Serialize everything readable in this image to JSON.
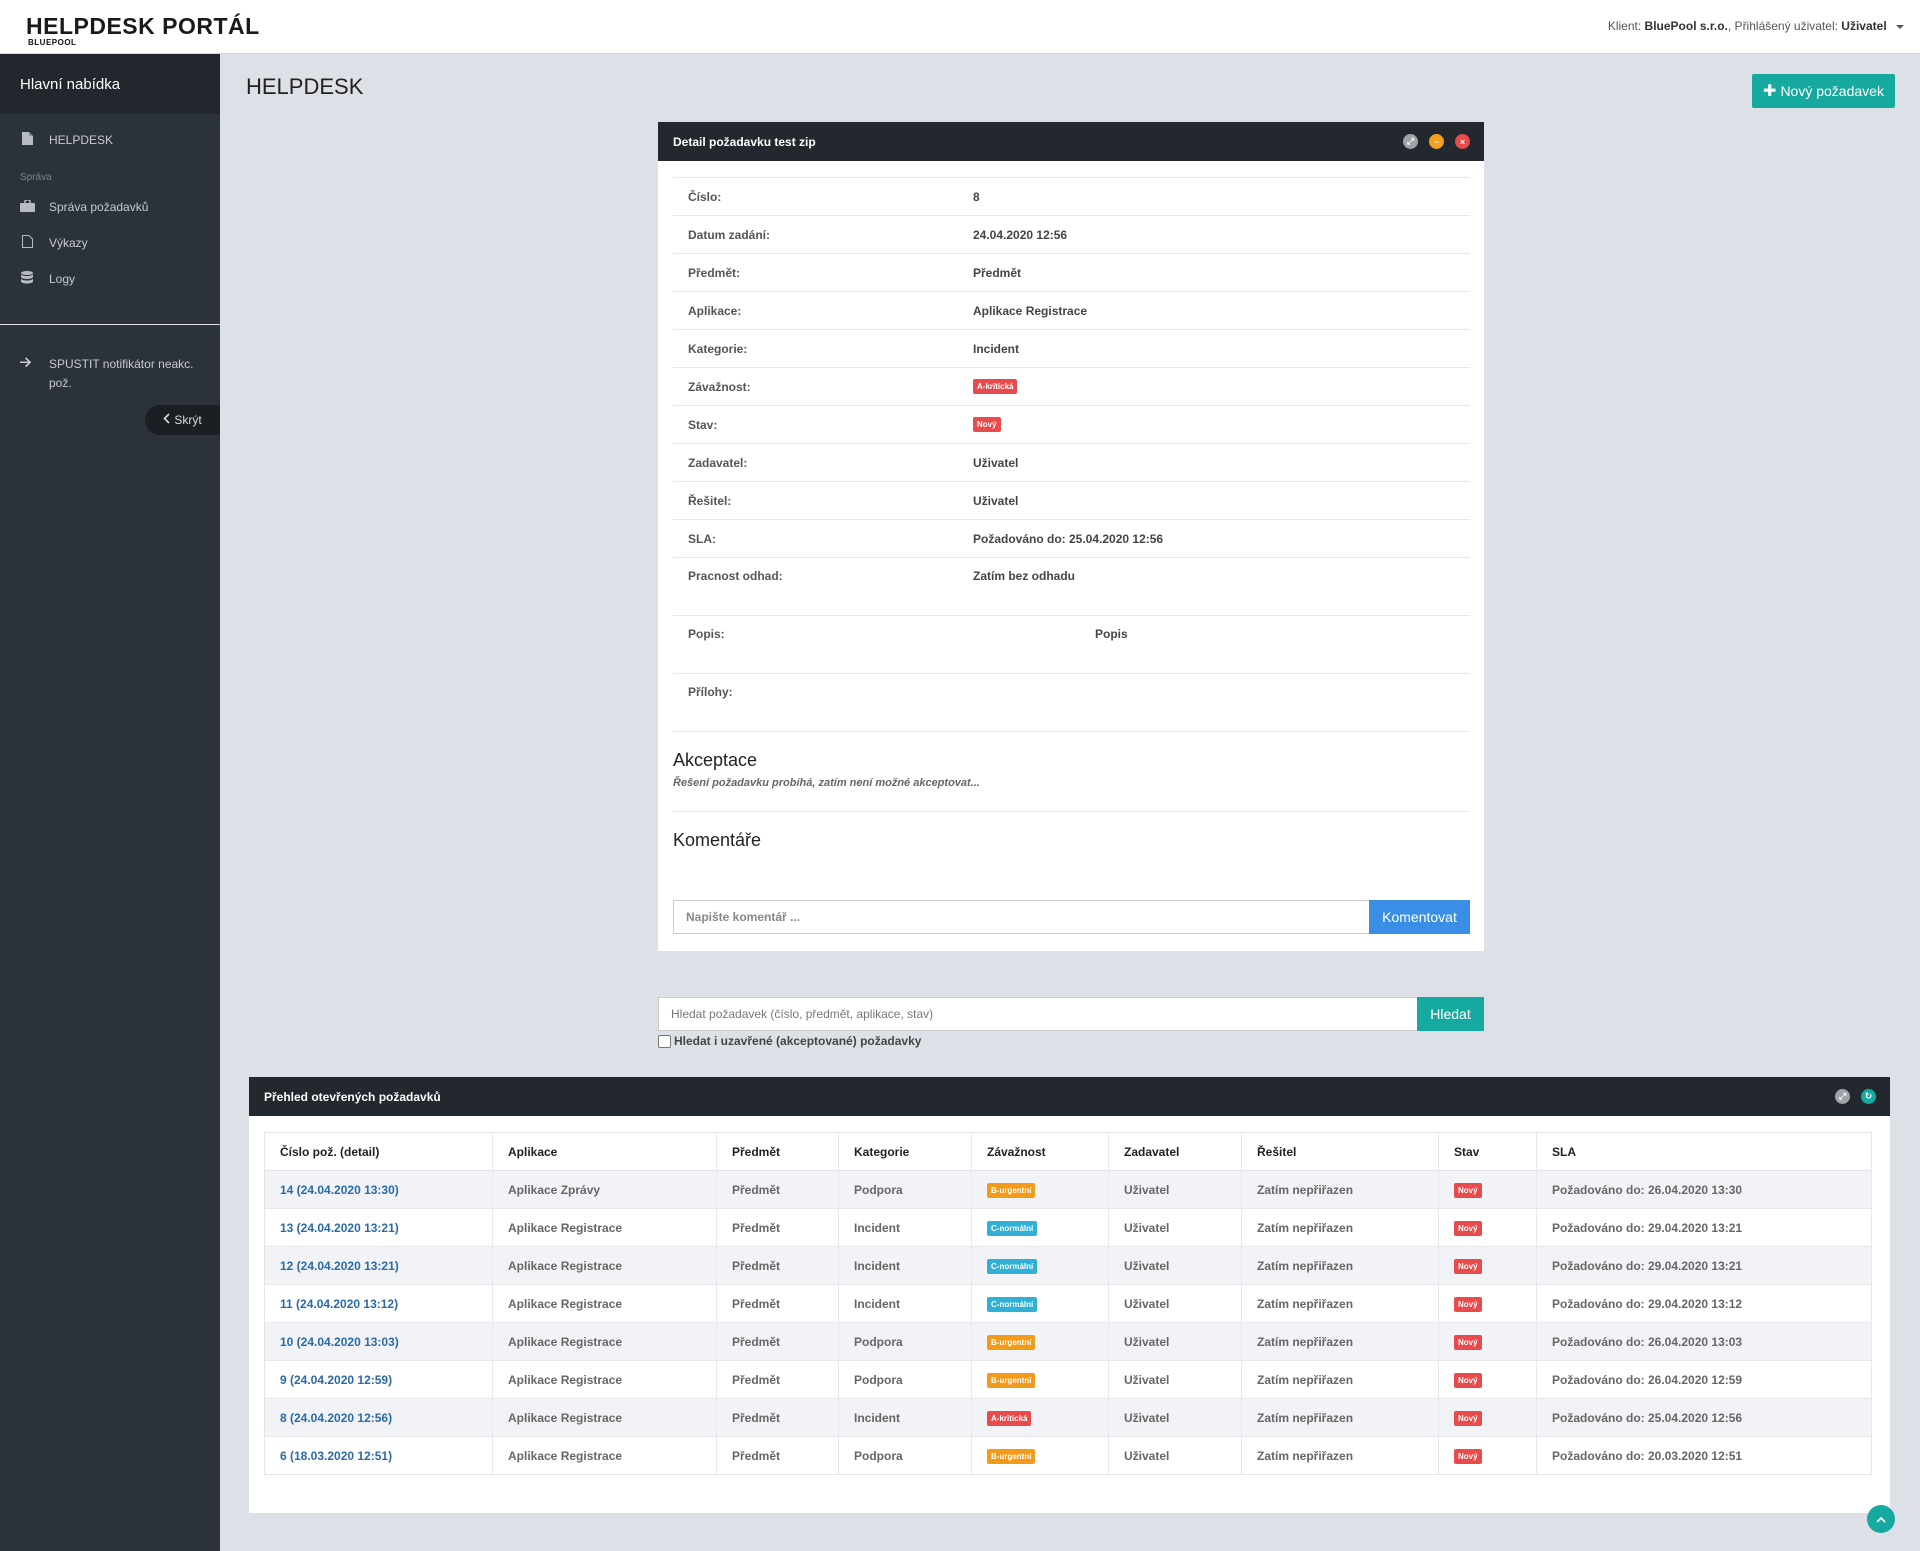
{
  "header": {
    "logo_title": "HELPDESK PORTÁL",
    "logo_sub": "BLUEPOOL",
    "client_label": "Klient:",
    "client_name": "BluePool s.r.o.",
    "user_label": ", Přihlášený uživatel:",
    "user_name": "Uživatel"
  },
  "sidebar": {
    "title": "Hlavní nabídka",
    "items": [
      {
        "label": "HELPDESK",
        "icon": "file-icon"
      },
      {
        "label": "Správa požadavků",
        "icon": "briefcase-icon"
      },
      {
        "label": "Výkazy",
        "icon": "document-icon"
      },
      {
        "label": "Logy",
        "icon": "database-icon"
      }
    ],
    "section_label": "Správa",
    "notifier_label": "SPUSTIT notifikátor neakc. pož.",
    "hide_label": "Skrýt"
  },
  "page": {
    "title": "HELPDESK",
    "new_button": "Nový požadavek"
  },
  "detail": {
    "title": "Detail požadavku test zip",
    "rows": [
      {
        "label": "Číslo:",
        "value": "8"
      },
      {
        "label": "Datum zadání:",
        "value": "24.04.2020 12:56"
      },
      {
        "label": "Předmět:",
        "value": "Předmět"
      },
      {
        "label": "Aplikace:",
        "value": "Aplikace Registrace"
      },
      {
        "label": "Kategorie:",
        "value": "Incident"
      },
      {
        "label": "Závažnost:",
        "value": "A-kritická"
      },
      {
        "label": "Stav:",
        "value": "Nový"
      },
      {
        "label": "Zadavatel:",
        "value": "Uživatel"
      },
      {
        "label": "Řešitel:",
        "value": "Uživatel"
      },
      {
        "label": "SLA:",
        "value": "Požadováno do: 25.04.2020 12:56"
      },
      {
        "label": "Pracnost odhad:",
        "value": "Zatím bez odhadu"
      },
      {
        "label": "Popis:",
        "value": "Popis"
      },
      {
        "label": "Přílohy:",
        "value": ""
      }
    ],
    "acceptance_title": "Akceptace",
    "acceptance_note": "Řešení požadavku probíhá, zatím není možné akceptovat...",
    "comments_title": "Komentáře",
    "comment_placeholder": "Napište komentář ...",
    "comment_button": "Komentovat"
  },
  "search": {
    "placeholder": "Hledat požadavek (číslo, předmět, aplikace, stav)",
    "button": "Hledat",
    "checkbox_label": "Hledat i uzavřené (akceptované) požadavky"
  },
  "overview": {
    "title": "Přehled otevřených požadavků",
    "columns": [
      "Číslo pož. (detail)",
      "Aplikace",
      "Předmět",
      "Kategorie",
      "Závažnost",
      "Zadavatel",
      "Řešitel",
      "Stav",
      "SLA"
    ],
    "rows": [
      {
        "id": "14 (24.04.2020 13:30)",
        "app": "Aplikace Zprávy",
        "subject": "Předmět",
        "category": "Podpora",
        "severity": "B-urgentní",
        "severity_color": "#f29b1a",
        "requester": "Uživatel",
        "solver": "Zatím nepřiřazen",
        "state": "Nový",
        "sla": "Požadováno do: 26.04.2020 13:30"
      },
      {
        "id": "13 (24.04.2020 13:21)",
        "app": "Aplikace Registrace",
        "subject": "Předmět",
        "category": "Incident",
        "severity": "C-normální",
        "severity_color": "#31b0d5",
        "requester": "Uživatel",
        "solver": "Zatím nepřiřazen",
        "state": "Nový",
        "sla": "Požadováno do: 29.04.2020 13:21"
      },
      {
        "id": "12 (24.04.2020 13:21)",
        "app": "Aplikace Registrace",
        "subject": "Předmět",
        "category": "Incident",
        "severity": "C-normální",
        "severity_color": "#31b0d5",
        "requester": "Uživatel",
        "solver": "Zatím nepřiřazen",
        "state": "Nový",
        "sla": "Požadováno do: 29.04.2020 13:21"
      },
      {
        "id": "11 (24.04.2020 13:12)",
        "app": "Aplikace Registrace",
        "subject": "Předmět",
        "category": "Incident",
        "severity": "C-normální",
        "severity_color": "#31b0d5",
        "requester": "Uživatel",
        "solver": "Zatím nepřiřazen",
        "state": "Nový",
        "sla": "Požadováno do: 29.04.2020 13:12"
      },
      {
        "id": "10 (24.04.2020 13:03)",
        "app": "Aplikace Registrace",
        "subject": "Předmět",
        "category": "Podpora",
        "severity": "B-urgentní",
        "severity_color": "#f29b1a",
        "requester": "Uživatel",
        "solver": "Zatím nepřiřazen",
        "state": "Nový",
        "sla": "Požadováno do: 26.04.2020 13:03"
      },
      {
        "id": "9 (24.04.2020 12:59)",
        "app": "Aplikace Registrace",
        "subject": "Předmět",
        "category": "Podpora",
        "severity": "B-urgentní",
        "severity_color": "#f29b1a",
        "requester": "Uživatel",
        "solver": "Zatím nepřiřazen",
        "state": "Nový",
        "sla": "Požadováno do: 26.04.2020 12:59"
      },
      {
        "id": "8 (24.04.2020 12:56)",
        "app": "Aplikace Registrace",
        "subject": "Předmět",
        "category": "Incident",
        "severity": "A-kritická",
        "severity_color": "#e84b4b",
        "requester": "Uživatel",
        "solver": "Zatím nepřiřazen",
        "state": "Nový",
        "sla": "Požadováno do: 25.04.2020 12:56"
      },
      {
        "id": "6 (18.03.2020 12:51)",
        "app": "Aplikace Registrace",
        "subject": "Předmět",
        "category": "Podpora",
        "severity": "B-urgentní",
        "severity_color": "#f29b1a",
        "requester": "Uživatel",
        "solver": "Zatím nepřiřazen",
        "state": "Nový",
        "sla": "Požadováno do: 20.03.2020 12:51"
      }
    ]
  },
  "colors": {
    "accent": "#16a99f",
    "dark": "#23272e",
    "danger": "#e84b4b",
    "warning": "#f29b1a",
    "info": "#31b0d5",
    "primary": "#3a8ee6"
  }
}
